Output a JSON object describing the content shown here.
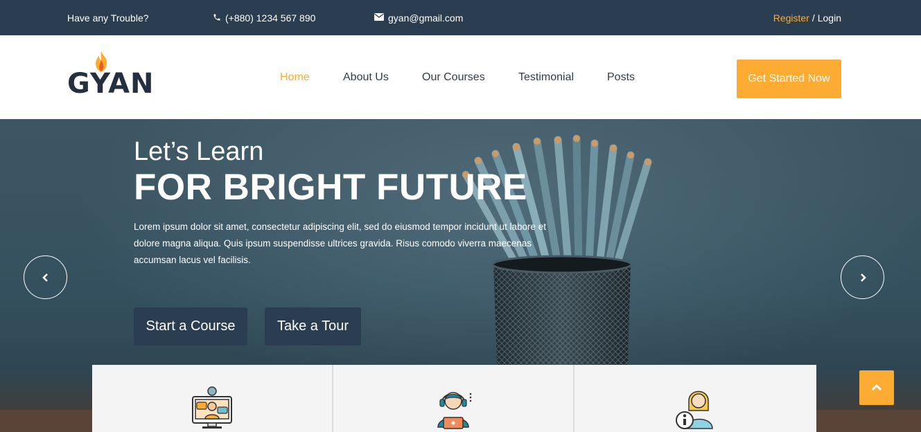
{
  "topbar": {
    "trouble": "Have any Trouble?",
    "phone": "(+880) 1234 567 890",
    "email": "gyan@gmail.com",
    "register": "Register",
    "separator": "/",
    "login": "Login",
    "phone_icon": "phone-icon",
    "email_icon": "envelope-icon"
  },
  "header": {
    "logo_text": "GYAN",
    "nav": [
      {
        "label": "Home",
        "active": true
      },
      {
        "label": "About Us",
        "active": false
      },
      {
        "label": "Our Courses",
        "active": false
      },
      {
        "label": "Testimonial",
        "active": false
      },
      {
        "label": "Posts",
        "active": false
      }
    ],
    "cta_label": "Get Started Now"
  },
  "hero": {
    "subtitle": "Let’s Learn",
    "title": "FOR BRIGHT FUTURE",
    "text": "Lorem ipsum dolor sit amet, consectetur adipiscing elit, sed do eiusmod tempor incidunt ut labore et dolore magna aliqua. Quis ipsum suspendisse ultrices gravida. Risus comodo viverra maecenas accumsan lacus vel facilisis.",
    "buttons": [
      "Start a Course",
      "Take a Tour"
    ]
  },
  "features": {
    "icons": [
      "online-teacher-icon",
      "support-agent-icon",
      "information-assistant-icon"
    ]
  },
  "colors": {
    "accent": "#fdac33",
    "dark": "#2b3d50",
    "logo": "#24303f"
  }
}
